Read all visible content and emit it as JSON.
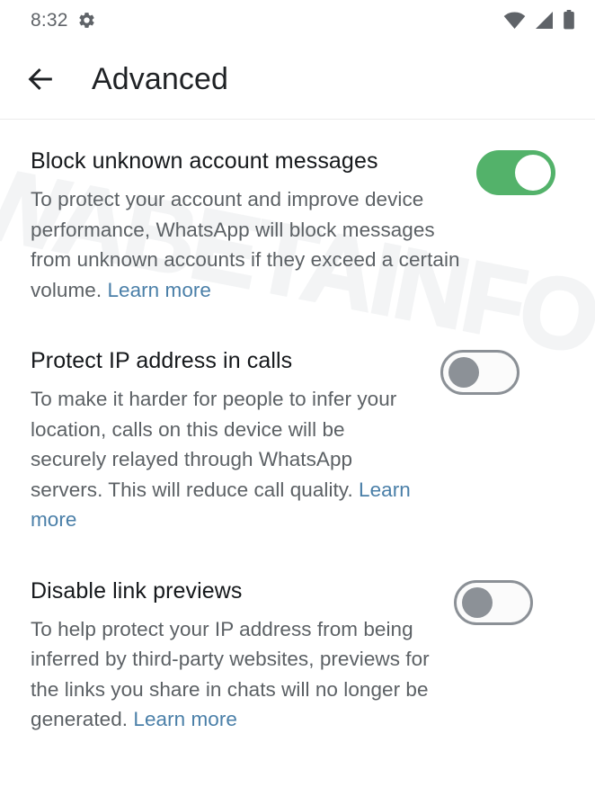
{
  "status_bar": {
    "time": "8:32",
    "icons": {
      "gear": "gear-icon",
      "wifi": "wifi-icon",
      "signal": "signal-icon",
      "battery": "battery-icon"
    }
  },
  "header": {
    "back_icon": "back-arrow-icon",
    "title": "Advanced"
  },
  "watermark": {
    "text": "WABETAINFO"
  },
  "colors": {
    "toggle_on": "#53b26a",
    "toggle_off_border": "#8b9096",
    "toggle_off_knob": "#8c9197",
    "link": "#4a7fa8",
    "title_text": "#15181b",
    "body_text": "#5c6165",
    "divider": "#ececec"
  },
  "settings": [
    {
      "title": "Block unknown account messages",
      "description": "To protect your account and improve device performance, WhatsApp will block messages from unknown accounts if they exceed a certain volume. ",
      "link_label": "Learn more",
      "toggle_state": "on"
    },
    {
      "title": "Protect IP address in calls",
      "description": "To make it harder for people to infer your location, calls on this device will be securely relayed through WhatsApp servers. This will reduce call quality. ",
      "link_label": "Learn more",
      "toggle_state": "off"
    },
    {
      "title": "Disable link previews",
      "description": "To help protect your IP address from being inferred by third-party websites, previews for the links you share in chats will no longer be generated. ",
      "link_label": "Learn more",
      "toggle_state": "off"
    }
  ]
}
